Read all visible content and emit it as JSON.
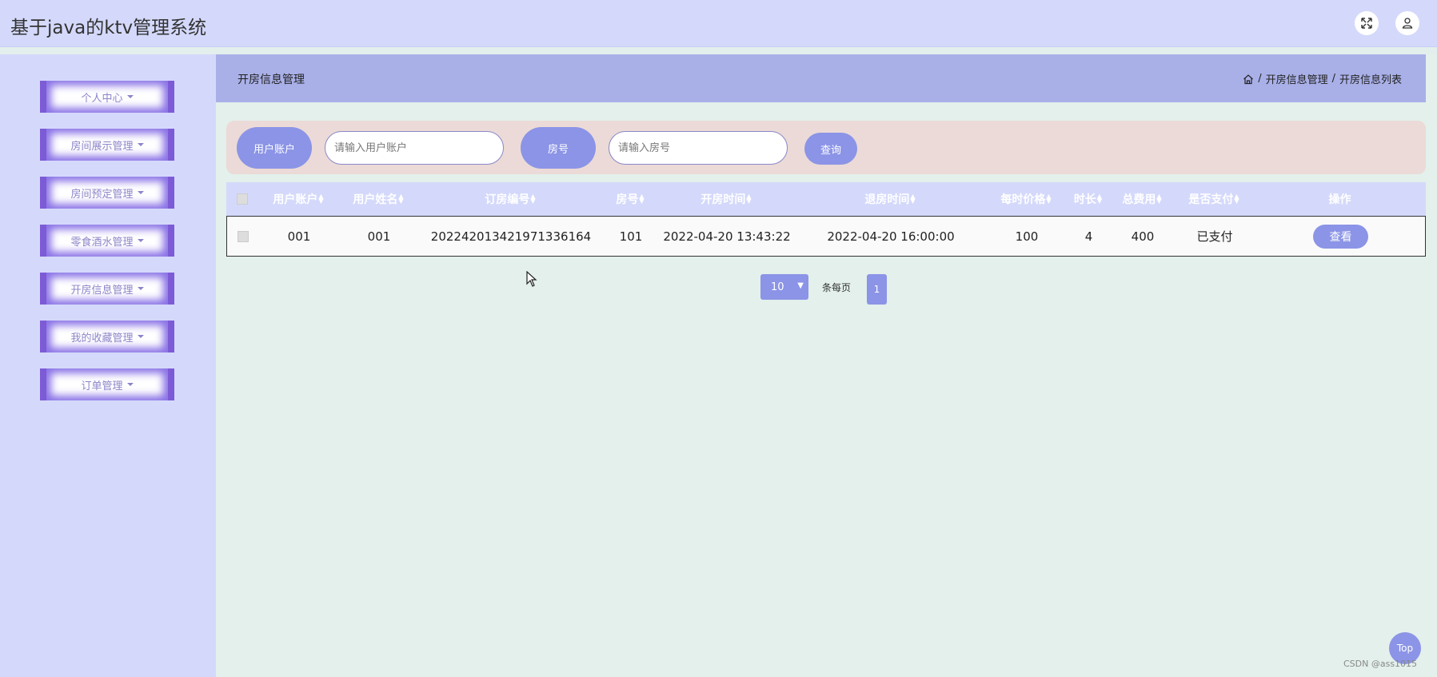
{
  "app": {
    "title": "基于java的ktv管理系统"
  },
  "header": {
    "icons": [
      "fullscreen-icon",
      "user-icon"
    ]
  },
  "sidebar": {
    "items": [
      {
        "label": "个人中心"
      },
      {
        "label": "房间展示管理"
      },
      {
        "label": "房间预定管理"
      },
      {
        "label": "零食酒水管理"
      },
      {
        "label": "开房信息管理"
      },
      {
        "label": "我的收藏管理"
      },
      {
        "label": "订单管理"
      }
    ]
  },
  "page": {
    "title": "开房信息管理",
    "breadcrumb": [
      "开房信息管理",
      "开房信息列表"
    ]
  },
  "search": {
    "account_label": "用户账户",
    "account_placeholder": "请输入用户账户",
    "room_label": "房号",
    "room_placeholder": "请输入房号",
    "query_label": "查询"
  },
  "table": {
    "columns": [
      "用户账户",
      "用户姓名",
      "订房编号",
      "房号",
      "开房时间",
      "退房时间",
      "每时价格",
      "时长",
      "总费用",
      "是否支付",
      "操作"
    ],
    "rows": [
      {
        "account": "001",
        "name": "001",
        "order_no": "20224201342197133616 4",
        "room": "101",
        "checkin": "2022-04-20 13:43:22",
        "checkout": "2022-04-20 16:00:00",
        "price": "100",
        "duration": "4",
        "total": "400",
        "paid": "已支付",
        "action": "查看"
      }
    ]
  },
  "pager": {
    "page_size": "10",
    "per_page_label": "条每页",
    "current_page": "1"
  },
  "footer": {
    "top_label": "Top",
    "watermark": "CSDN @ass1015"
  },
  "colors": {
    "accent": "#8b94e6",
    "sidebar_bg": "#d4d9fb",
    "content_bg": "#e3f0ec",
    "crumb_bg": "#a9b0e8",
    "search_bg": "#ebdad7",
    "menu_border": "#7d5ad6"
  }
}
